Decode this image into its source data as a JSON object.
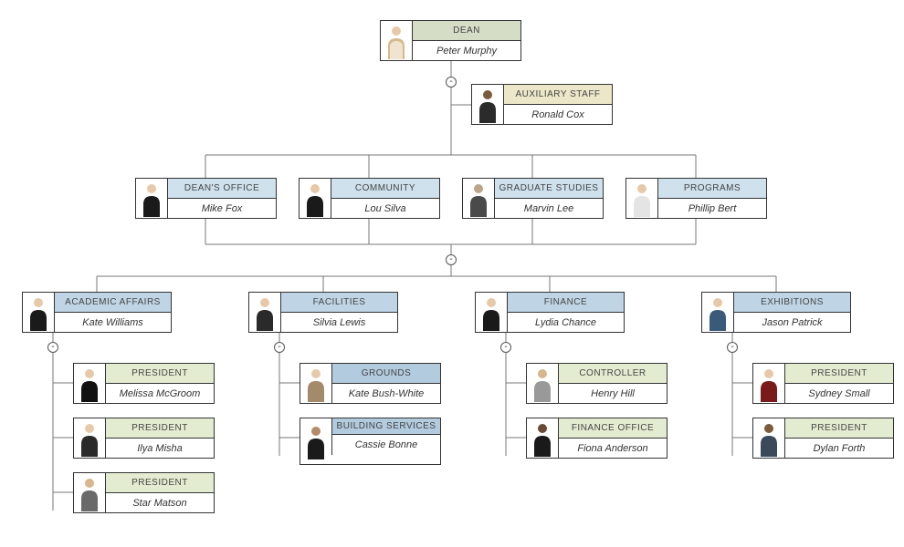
{
  "org": {
    "dean": {
      "title": "DEAN",
      "name": "Peter Murphy"
    },
    "aux": {
      "title": "AUXILIARY STAFF",
      "name": "Ronald Cox"
    },
    "deans_office": {
      "title": "DEAN'S OFFICE",
      "name": "Mike Fox"
    },
    "community": {
      "title": "COMMUNITY",
      "name": "Lou Silva"
    },
    "grad_studies": {
      "title": "GRADUATE STUDIES",
      "name": "Marvin Lee"
    },
    "programs": {
      "title": "PROGRAMS",
      "name": "Phillip Bert"
    },
    "academic": {
      "title": "ACADEMIC AFFAIRS",
      "name": "Kate Williams"
    },
    "facilities": {
      "title": "FACILITIES",
      "name": "Silvia Lewis"
    },
    "finance": {
      "title": "FINANCE",
      "name": "Lydia Chance"
    },
    "exhibitions": {
      "title": "EXHIBITIONS",
      "name": "Jason Patrick"
    },
    "acad_pres1": {
      "title": "PRESIDENT",
      "name": "Melissa McGroom"
    },
    "acad_pres2": {
      "title": "PRESIDENT",
      "name": "Ilya Misha"
    },
    "acad_pres3": {
      "title": "PRESIDENT",
      "name": "Star Matson"
    },
    "grounds": {
      "title": "GROUNDS",
      "name": "Kate Bush-White"
    },
    "building_serv": {
      "title": "BUILDING SERVICES",
      "name": "Cassie Bonne"
    },
    "controller": {
      "title": "CONTROLLER",
      "name": "Henry Hill"
    },
    "finance_office": {
      "title": "FINANCE OFFICE",
      "name": "Fiona Anderson"
    },
    "exh_pres1": {
      "title": "PRESIDENT",
      "name": "Sydney Small"
    },
    "exh_pres2": {
      "title": "PRESIDENT",
      "name": "Dylan Forth"
    }
  },
  "toggles": {
    "t1": "-",
    "t2": "-",
    "t3": "-",
    "t4": "-",
    "t5": "-",
    "t6": "-"
  }
}
